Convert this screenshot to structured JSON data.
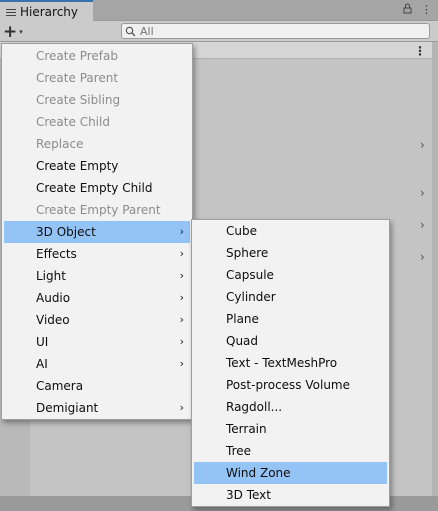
{
  "window": {
    "tab_title": "Hierarchy",
    "lock_glyph": "🔒",
    "more_glyph": "⋮"
  },
  "toolbar": {
    "create_glyph": "+",
    "create_caret": "▾",
    "search_placeholder": "All"
  },
  "scene": {
    "menu_glyph": "⋮",
    "row_arrow": "›"
  },
  "context_menu": {
    "items": [
      {
        "label": "Create Prefab",
        "disabled": true
      },
      {
        "label": "Create Parent",
        "disabled": true
      },
      {
        "label": "Create Sibling",
        "disabled": true
      },
      {
        "label": "Create Child",
        "disabled": true
      },
      {
        "label": "Replace",
        "disabled": true
      },
      {
        "label": "Create Empty",
        "disabled": false
      },
      {
        "label": "Create Empty Child",
        "disabled": false
      },
      {
        "label": "Create Empty Parent",
        "disabled": true
      },
      {
        "label": "3D Object",
        "submenu": true,
        "selected": true
      },
      {
        "label": "Effects",
        "submenu": true
      },
      {
        "label": "Light",
        "submenu": true
      },
      {
        "label": "Audio",
        "submenu": true
      },
      {
        "label": "Video",
        "submenu": true
      },
      {
        "label": "UI",
        "submenu": true
      },
      {
        "label": "AI",
        "submenu": true
      },
      {
        "label": "Camera"
      },
      {
        "label": "Demigiant",
        "submenu": true
      }
    ],
    "submenu_arrow": "›"
  },
  "submenu_3d_object": {
    "items": [
      {
        "label": "Cube"
      },
      {
        "label": "Sphere"
      },
      {
        "label": "Capsule"
      },
      {
        "label": "Cylinder"
      },
      {
        "label": "Plane"
      },
      {
        "label": "Quad"
      },
      {
        "label": "Text - TextMeshPro"
      },
      {
        "label": "Post-process Volume"
      },
      {
        "label": "Ragdoll..."
      },
      {
        "label": "Terrain"
      },
      {
        "label": "Tree"
      },
      {
        "label": "Wind Zone",
        "selected": true
      },
      {
        "label": "3D Text"
      }
    ]
  }
}
